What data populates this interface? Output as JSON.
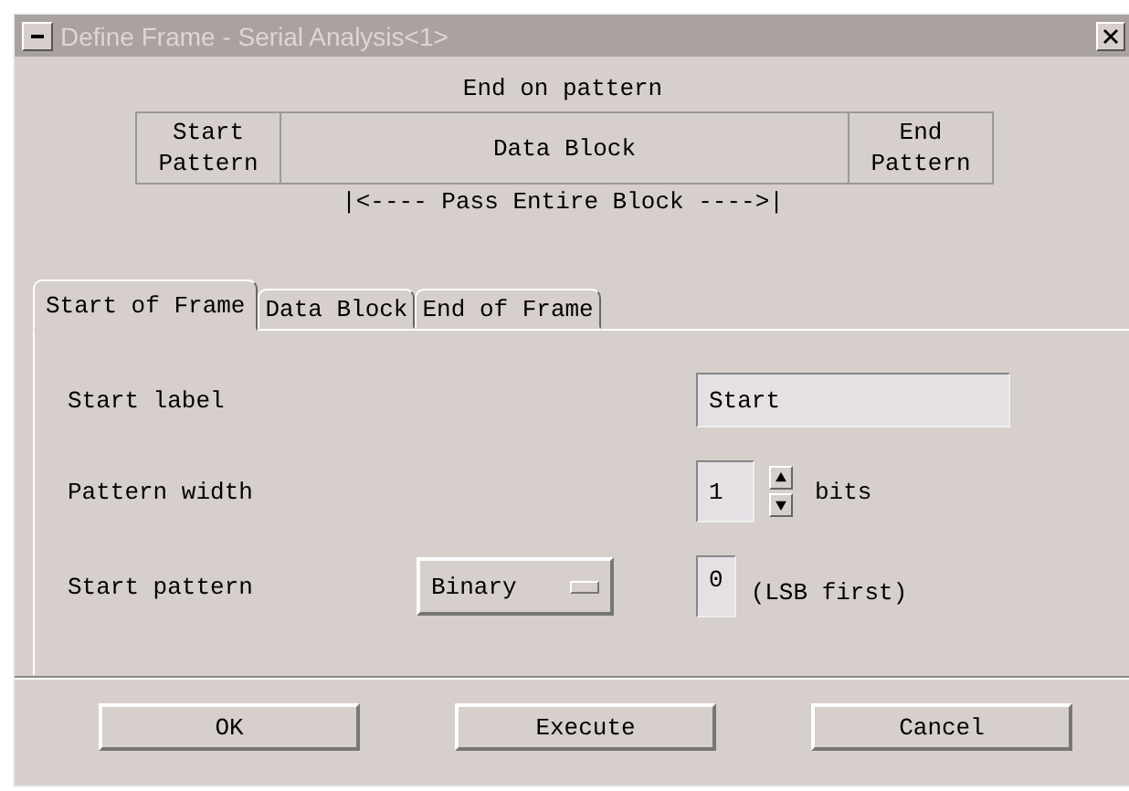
{
  "window": {
    "title": "Define Frame - Serial Analysis<1>"
  },
  "caption": "End on pattern",
  "diagram": {
    "cells": [
      {
        "kind": "edge",
        "text": "Start\nPattern"
      },
      {
        "kind": "body",
        "text": "Data Block"
      },
      {
        "kind": "edge",
        "text": "End\nPattern"
      }
    ],
    "span_label": "|<---- Pass Entire Block ---->|"
  },
  "tabs": [
    {
      "label": "Start of Frame",
      "selected": true
    },
    {
      "label": "Data Block",
      "selected": false
    },
    {
      "label": "End of Frame",
      "selected": false
    }
  ],
  "form": {
    "start_label": {
      "label": "Start label",
      "value": "Start"
    },
    "pattern_width": {
      "label": "Pattern width",
      "value": "1",
      "unit": "bits"
    },
    "start_pattern": {
      "label": "Start pattern",
      "format": "Binary",
      "value": "0",
      "note": "(LSB first)"
    }
  },
  "buttons": [
    "OK",
    "Execute",
    "Cancel"
  ]
}
